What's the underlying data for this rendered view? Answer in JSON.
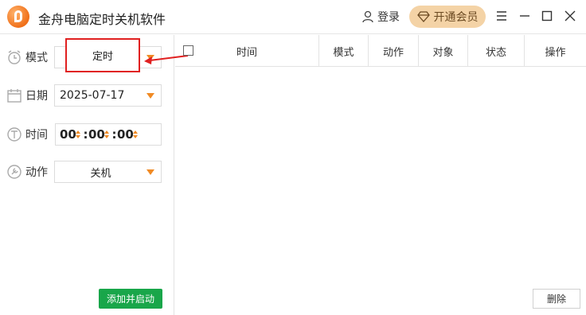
{
  "app": {
    "title": "金舟电脑定时关机软件"
  },
  "header": {
    "login_label": "登录",
    "vip_label": "开通会员",
    "controls": [
      "menu-icon",
      "minimize-icon",
      "maximize-icon",
      "close-icon"
    ]
  },
  "form": {
    "mode": {
      "label": "模式",
      "value": "定时"
    },
    "date": {
      "label": "日期",
      "value": "2025-07-17"
    },
    "time": {
      "label": "时间",
      "hours": "00",
      "minutes": "00",
      "seconds": "00"
    },
    "action": {
      "label": "动作",
      "value": "关机"
    },
    "add_button": "添加并启动"
  },
  "table": {
    "columns": [
      "时间",
      "模式",
      "动作",
      "对象",
      "状态",
      "操作"
    ],
    "rows": []
  },
  "delete_button": "删除",
  "colors": {
    "accent": "#f08a24",
    "green": "#19a64a",
    "highlight": "#e02020",
    "vip_bg": "#f4d3a6"
  }
}
